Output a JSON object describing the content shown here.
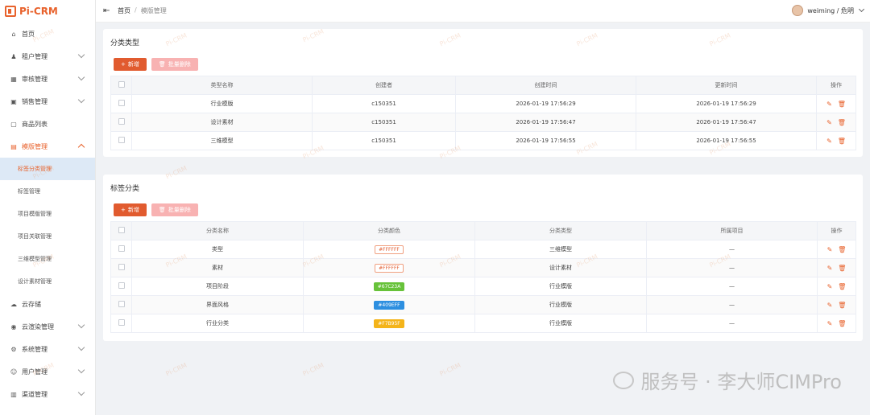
{
  "app": {
    "logo": "Pi-CRM"
  },
  "sidebar": {
    "items": [
      {
        "label": "首页",
        "icon": "home-icon",
        "glyph": "⌂",
        "chevron": false
      },
      {
        "label": "租户管理",
        "icon": "tenant-icon",
        "glyph": "♟",
        "chevron": true
      },
      {
        "label": "审核管理",
        "icon": "audit-icon",
        "glyph": "▦",
        "chevron": true
      },
      {
        "label": "销售管理",
        "icon": "sales-icon",
        "glyph": "▣",
        "chevron": true
      },
      {
        "label": "商品列表",
        "icon": "product-icon",
        "glyph": "▢",
        "chevron": false
      },
      {
        "label": "模版管理",
        "icon": "template-icon",
        "glyph": "▤",
        "chevron": true,
        "open": true
      }
    ],
    "subitems": [
      {
        "label": "标签分类管理",
        "active": true
      },
      {
        "label": "标签管理"
      },
      {
        "label": "项目模版管理"
      },
      {
        "label": "项目关联管理"
      },
      {
        "label": "三维模型管理"
      },
      {
        "label": "设计素材管理"
      }
    ],
    "items_after": [
      {
        "label": "云存储",
        "icon": "cloud-icon",
        "glyph": "☁",
        "chevron": false
      },
      {
        "label": "云渲染管理",
        "icon": "render-icon",
        "glyph": "◉",
        "chevron": true
      },
      {
        "label": "系统管理",
        "icon": "settings-icon",
        "glyph": "⚙",
        "chevron": true
      },
      {
        "label": "用户管理",
        "icon": "user-icon",
        "glyph": "☺",
        "chevron": true
      },
      {
        "label": "渠道管理",
        "icon": "channel-icon",
        "glyph": "▥",
        "chevron": true
      }
    ]
  },
  "topbar": {
    "breadcrumb_home": "首页",
    "breadcrumb_sep": "/",
    "breadcrumb_current": "模版管理",
    "user": "weiming / 危明"
  },
  "panel1": {
    "title": "分类类型",
    "add_label": "新增",
    "del_label": "批量删除",
    "columns": [
      "类型名称",
      "创建者",
      "创建时间",
      "更新时间",
      "操作"
    ],
    "rows": [
      [
        "行业模版",
        "c150351",
        "2026-01-19 17:56:29",
        "2026-01-19 17:56:29"
      ],
      [
        "设计素材",
        "c150351",
        "2026-01-19 17:56:47",
        "2026-01-19 17:56:47"
      ],
      [
        "三维模型",
        "c150351",
        "2026-01-19 17:56:55",
        "2026-01-19 17:56:55"
      ]
    ]
  },
  "panel2": {
    "title": "标签分类",
    "add_label": "新增",
    "del_label": "批量删除",
    "columns": [
      "分类名称",
      "分类颜色",
      "分类类型",
      "所属项目",
      "操作"
    ],
    "rows": [
      {
        "name": "类型",
        "color": "#FFFFFF",
        "chip_bg": "#ffffff",
        "chip_fg": "#e15b2f",
        "type": "三维模型",
        "project": "—"
      },
      {
        "name": "素材",
        "color": "#FFFFFF",
        "chip_bg": "#ffffff",
        "chip_fg": "#e15b2f",
        "type": "设计素材",
        "project": "—"
      },
      {
        "name": "项目阶段",
        "color": "#67C23A",
        "chip_bg": "#67c23a",
        "chip_fg": "#ffffff",
        "type": "行业模版",
        "project": "—"
      },
      {
        "name": "界面风格",
        "color": "#409EFF",
        "chip_bg": "#2d8fe0",
        "chip_fg": "#ffffff",
        "type": "行业模版",
        "project": "—"
      },
      {
        "name": "行业分类",
        "color": "#F7B95F",
        "chip_bg": "#f4b41a",
        "chip_fg": "#ffffff",
        "type": "行业模版",
        "project": "—"
      }
    ]
  },
  "watermark": {
    "text": "Pi-CRM",
    "footer": "服务号 · 李大师CIMPro"
  }
}
